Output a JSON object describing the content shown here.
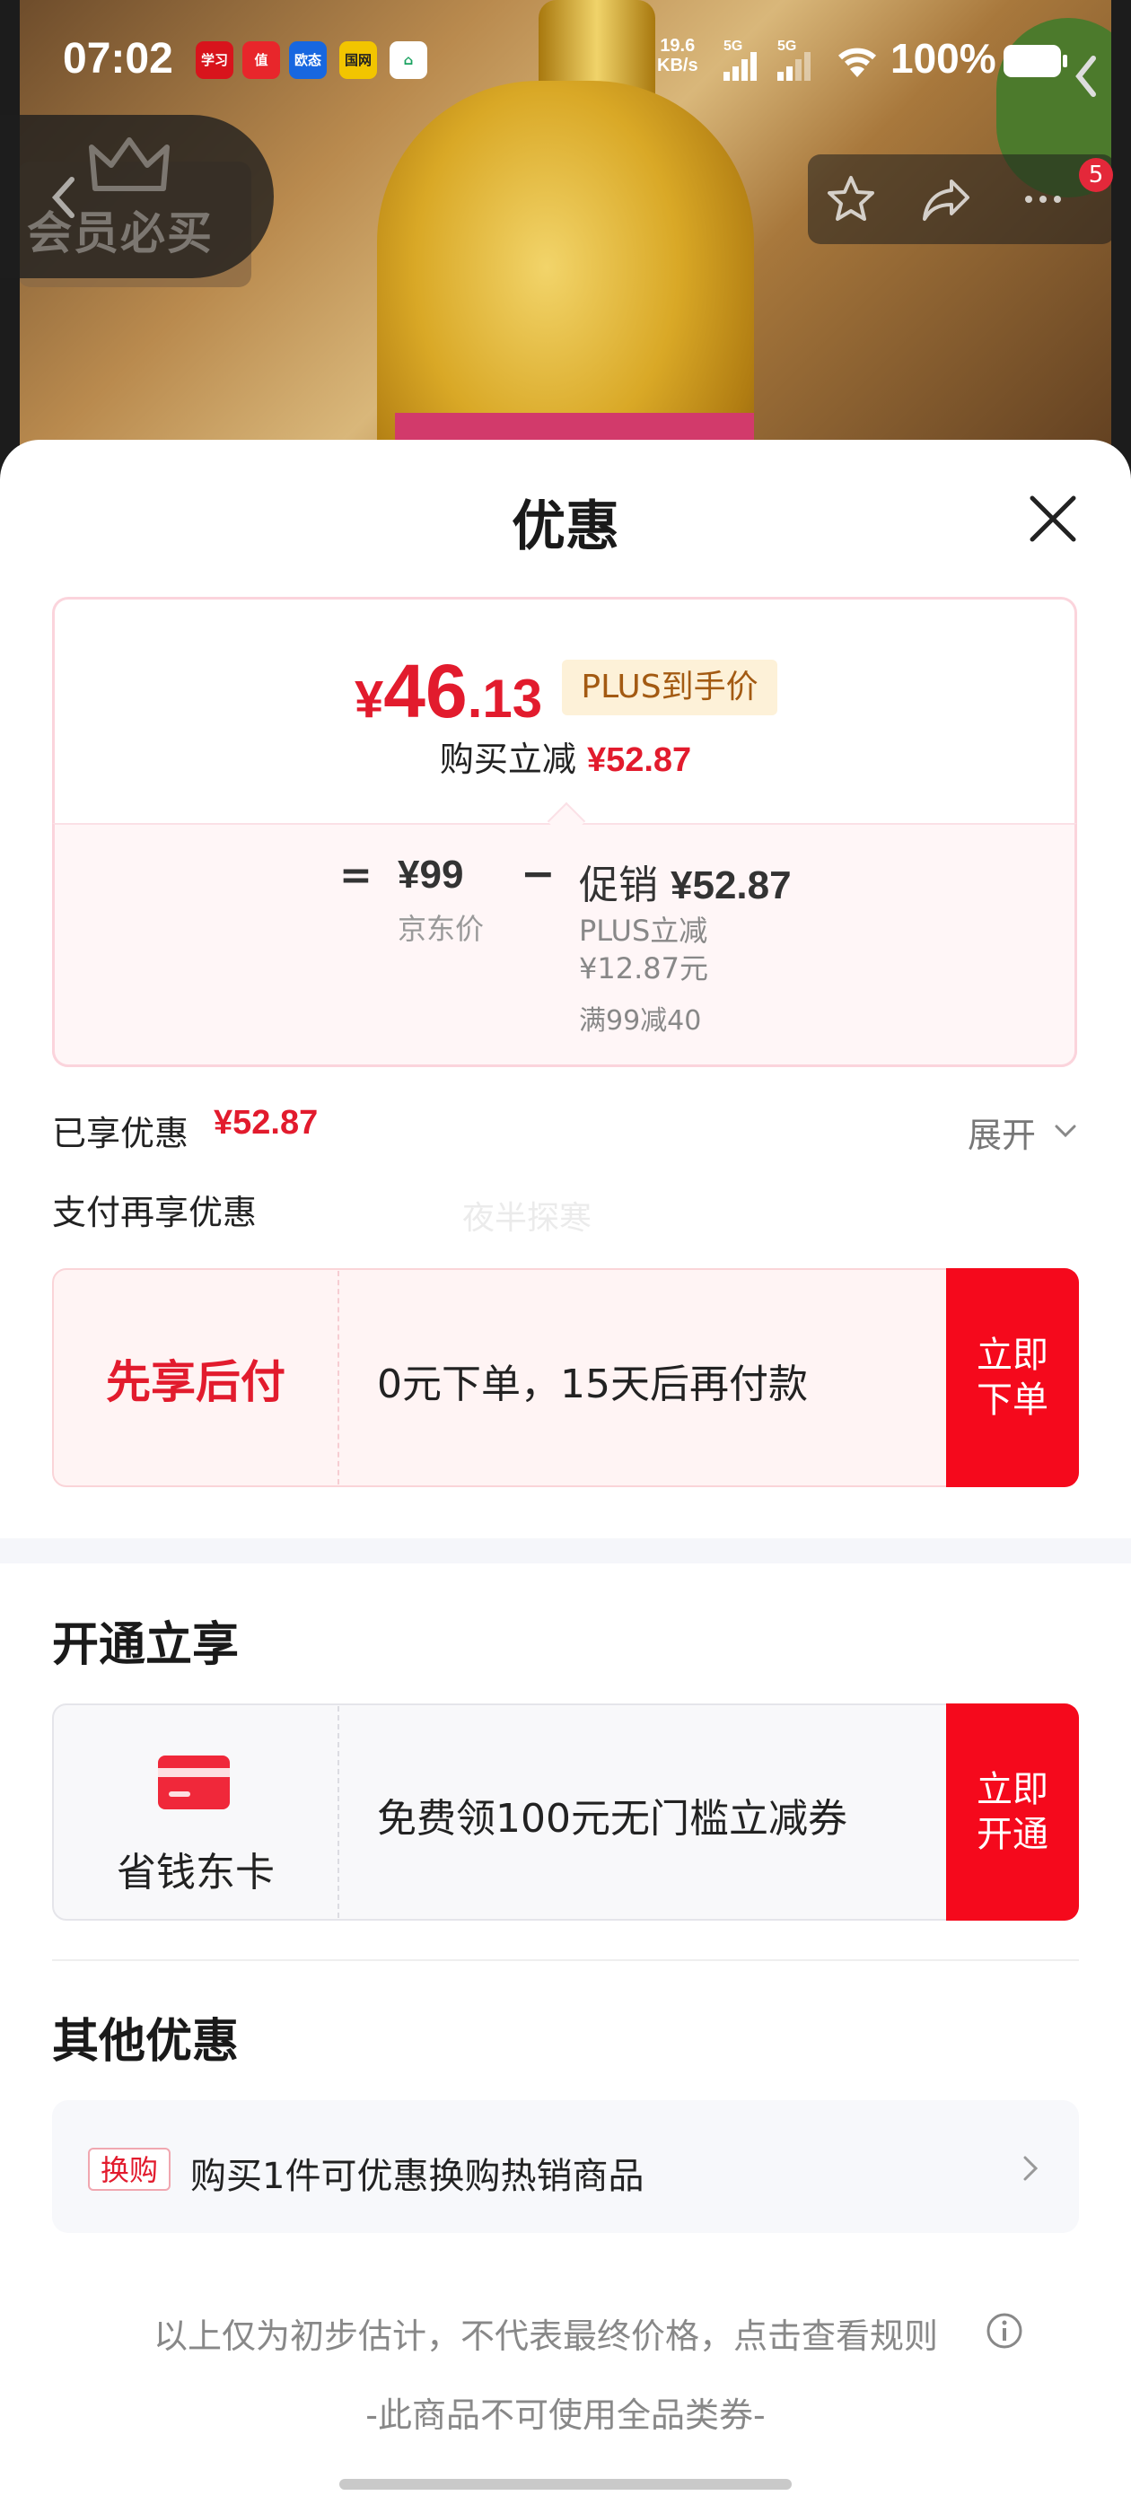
{
  "status_bar": {
    "time": "07:02",
    "net_speed_value": "19.6",
    "net_speed_unit": "KB/s",
    "signal_1": "5G",
    "signal_2": "5G",
    "battery": "100%",
    "app_icons": [
      "app-red-icon",
      "zhi-icon",
      "oupu-icon",
      "mall-icon",
      "home-app-icon"
    ],
    "app_icon_labels": [
      "学习",
      "值",
      "欧态",
      "国网",
      ""
    ]
  },
  "product_nav": {
    "member_label": "会员必买",
    "cart_count": "5"
  },
  "sheet": {
    "title": "优惠",
    "price": {
      "currency": "¥",
      "integer": "46",
      "decimal": ".13",
      "tag": "PLUS到手价",
      "reduce_prefix": "购买立减",
      "reduce_value": "¥52.87"
    },
    "breakdown": {
      "equals": "=",
      "jd_price": "¥99",
      "jd_label": "京东价",
      "minus": "−",
      "promo_label": "促销",
      "promo_value": "¥52.87",
      "promo_detail_1": "PLUS立减",
      "promo_detail_2": "¥12.87元",
      "promo_detail_3": "满99减40"
    },
    "enjoyed_label": "已享优惠",
    "enjoyed_value": "¥52.87",
    "expand_label": "展开",
    "pay_more_label": "支付再享优惠",
    "watermark": "夜半探寒",
    "bnpl": {
      "title": "先享后付",
      "description": "0元下单，15天后再付款",
      "button": "立即下单"
    },
    "open_section_title": "开通立享",
    "card_offer": {
      "name": "省钱东卡",
      "description": "免费领100元无门槛立减券",
      "button": "立即开通"
    },
    "other_section_title": "其他优惠",
    "swap": {
      "tag": "换购",
      "text": "购买1件可优惠换购热销商品"
    },
    "disclaimer": "以上仅为初步估计，不代表最终价格，点击查看规则",
    "no_coupon": "-此商品不可使用全品类券-"
  },
  "colors": {
    "accent_red": "#e21b2d",
    "button_red": "#f5091c",
    "plus_tag_bg": "#fdf1d8",
    "plus_tag_text": "#a35a12"
  }
}
